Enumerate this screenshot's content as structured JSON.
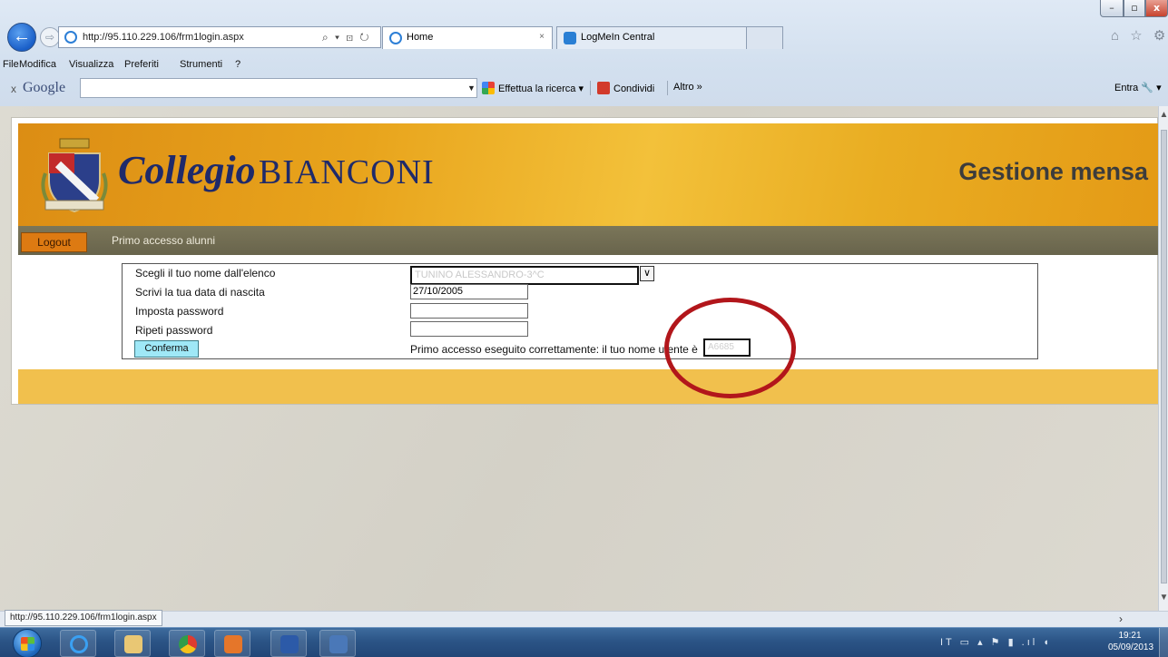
{
  "browser": {
    "address_url": "http://95.110.229.106/frm1login.aspx",
    "address_tools": "⌕ ▾ ⊡ ↻",
    "tabs": [
      {
        "label": "Home",
        "close": "×"
      },
      {
        "label": "LogMeIn Central"
      }
    ],
    "window_buttons": {
      "minimize": "–",
      "maximize": "▫",
      "close": "x"
    },
    "fav_icons": "⌂ ☆ ⚙",
    "menu": [
      "File",
      "Modifica",
      "Visualizza",
      "Preferiti",
      "Strumenti",
      "?"
    ],
    "google_toolbar": {
      "close": "x",
      "logo": "Google",
      "search_value": "",
      "search_button": "Effettua la ricerca ▾",
      "share_button": "Condividi",
      "more_button": "Altro »",
      "signin": "Entra 🔧 ▾"
    },
    "status_url": "http://95.110.229.106/frm1login.aspx"
  },
  "site": {
    "brand_script": "Collegio",
    "brand_caps": "BIANCONI",
    "app_title": "Gestione mensa",
    "logout_label": "Logout",
    "nav_link": "Primo accesso alunni"
  },
  "form": {
    "label_name": "Scegli il tuo nome dall'elenco",
    "label_birth": "Scrivi la tua data di nascita",
    "label_password": "Imposta password",
    "label_repeat": "Ripeti password",
    "select_value": "TUNINO ALESSANDRO-3^C",
    "birth_value": "27/10/2005",
    "password_value": "",
    "repeat_value": "",
    "confirm_label": "Conferma",
    "result_message": "Primo accesso eseguito correttamente: il tuo nome utente è",
    "username_value": "A6685"
  },
  "taskbar": {
    "tray_text": "IT ▭ ▴ ⚑ ▮ .ıl ◖",
    "clock_time": "19:21",
    "clock_date": "05/09/2013"
  },
  "colors": {
    "banner_orange": "#e8a41c",
    "nav_olive": "#6f6a50",
    "logout_orange": "#dd7a12",
    "confirm_cyan": "#9fe8f7",
    "highlight_red": "#b2161b",
    "footer_band": "#f1c04d"
  }
}
